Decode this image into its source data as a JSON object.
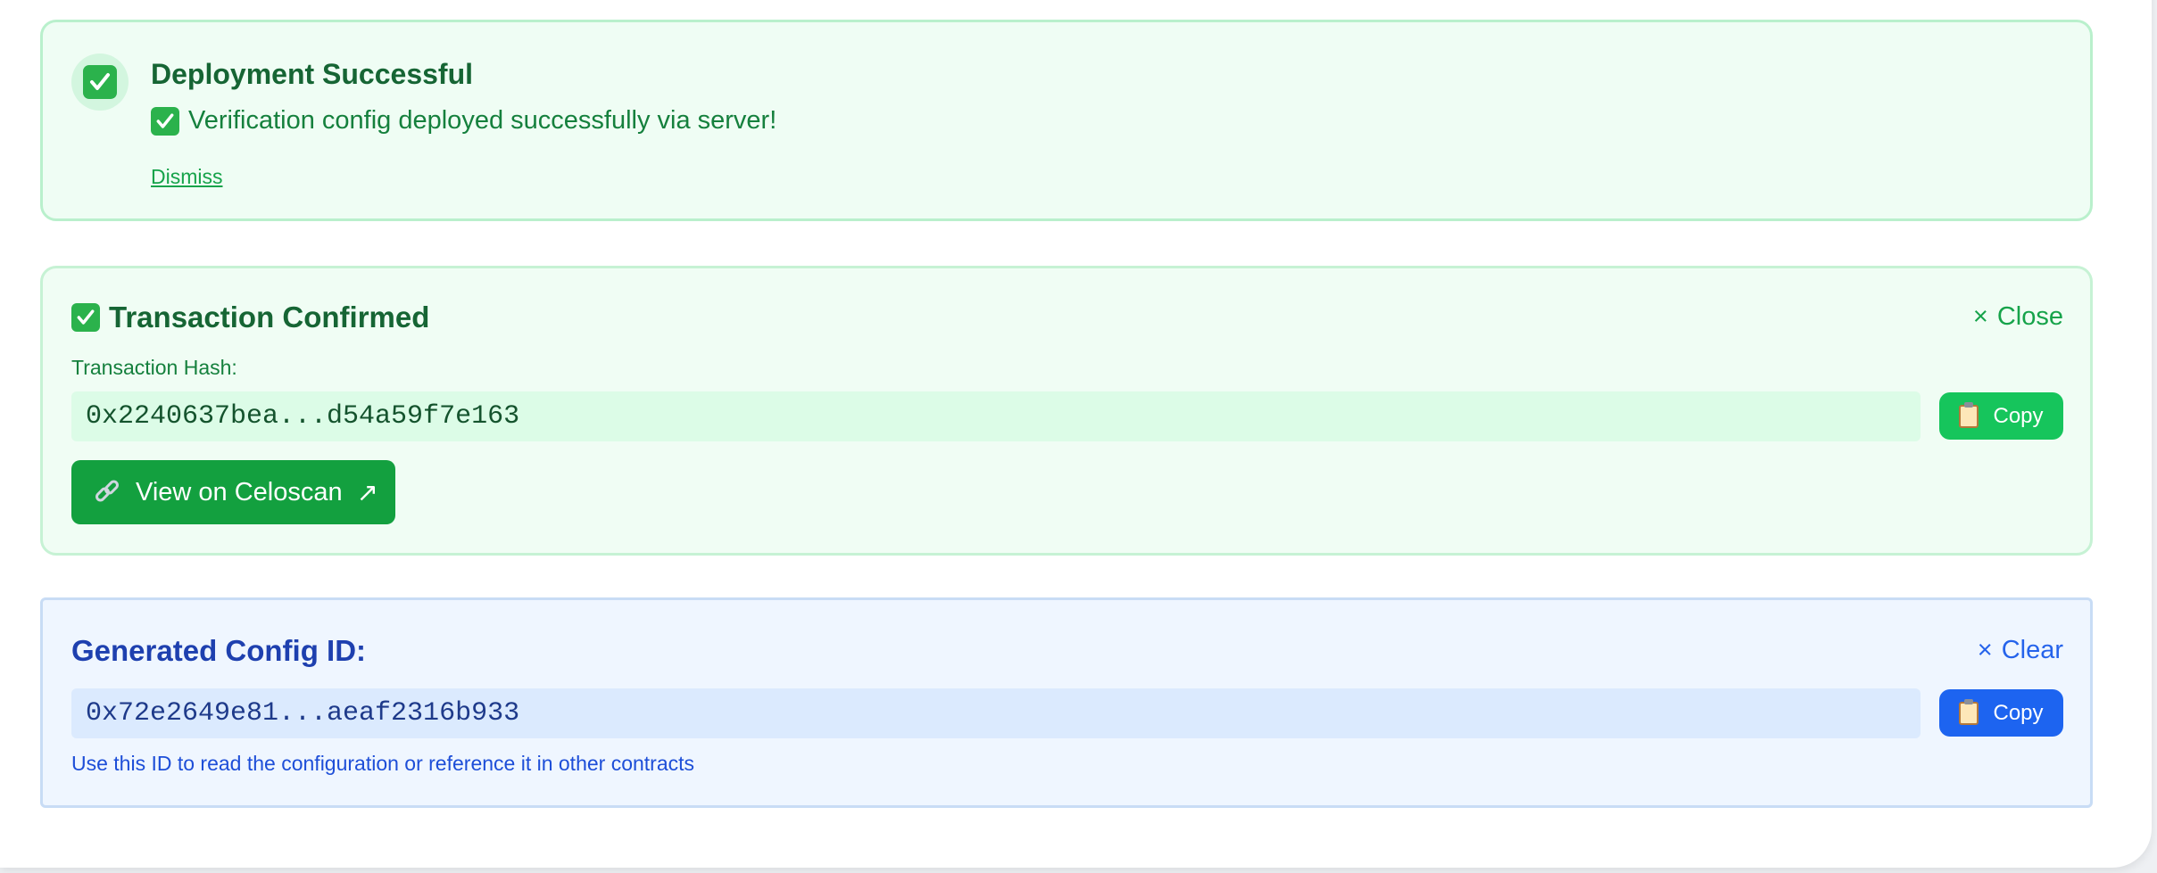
{
  "deployment": {
    "title": "Deployment Successful",
    "message": "Verification config deployed successfully via server!",
    "dismiss_label": "Dismiss",
    "icon": "check-box-icon"
  },
  "transaction": {
    "title": "Transaction Confirmed",
    "close_label": "Close",
    "close_icon": "×",
    "hash_label": "Transaction Hash:",
    "hash": "0x2240637bea...d54a59f7e163",
    "copy_label": "Copy",
    "view_label": "View on Celoscan",
    "external_icon": "↗"
  },
  "config": {
    "title": "Generated Config ID:",
    "clear_label": "Clear",
    "clear_icon": "×",
    "id": "0x72e2649e81...aeaf2316b933",
    "copy_label": "Copy",
    "hint": "Use this ID to read the configuration or reference it in other contracts"
  },
  "colors": {
    "success_green": "#16a34a",
    "success_bg": "#f0fdf4",
    "info_blue": "#1d64f0",
    "info_bg": "#eff6ff"
  }
}
